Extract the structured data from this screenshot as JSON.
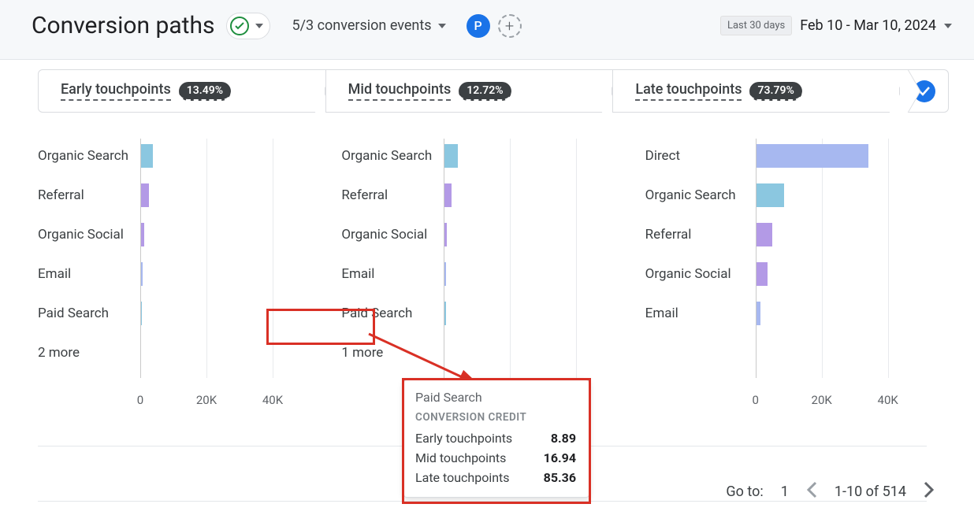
{
  "header": {
    "title": "Conversion paths",
    "events_label": "5/3 conversion events",
    "p_icon": "P",
    "date_label": "Last 30 days",
    "date_range": "Feb 10 - Mar 10, 2024"
  },
  "touchpoints": [
    {
      "label": "Early touchpoints",
      "pct": "13.49%"
    },
    {
      "label": "Mid touchpoints",
      "pct": "12.72%"
    },
    {
      "label": "Late touchpoints",
      "pct": "73.79%"
    }
  ],
  "chart_data": [
    {
      "type": "bar",
      "title": "Early touchpoints",
      "xlabel": "",
      "ylabel": "",
      "xlim": [
        0,
        50000
      ],
      "ticks": [
        "0",
        "20K",
        "40K"
      ],
      "series": [
        {
          "name": "credit",
          "values": [
            3600,
            2400,
            900,
            500,
            300
          ]
        }
      ],
      "categories": [
        "Organic Search",
        "Referral",
        "Organic Social",
        "Email",
        "Paid Search"
      ],
      "more_label": "2 more",
      "colors": [
        "teal",
        "purple",
        "purple",
        "lav",
        "teal"
      ]
    },
    {
      "type": "bar",
      "title": "Mid touchpoints",
      "xlabel": "",
      "ylabel": "",
      "xlim": [
        0,
        50000
      ],
      "ticks": [
        "0",
        "20K",
        "40K"
      ],
      "series": [
        {
          "name": "credit",
          "values": [
            4000,
            2000,
            700,
            500,
            300
          ]
        }
      ],
      "categories": [
        "Organic Search",
        "Referral",
        "Organic Social",
        "Email",
        "Paid Search"
      ],
      "more_label": "1 more",
      "colors": [
        "teal",
        "purple",
        "purple",
        "lav",
        "teal"
      ]
    },
    {
      "type": "bar",
      "title": "Late touchpoints",
      "xlabel": "",
      "ylabel": "",
      "xlim": [
        0,
        50000
      ],
      "ticks": [
        "0",
        "20K",
        "40K"
      ],
      "series": [
        {
          "name": "credit",
          "values": [
            34000,
            8500,
            4800,
            3500,
            1200
          ]
        }
      ],
      "categories": [
        "Direct",
        "Organic Search",
        "Referral",
        "Organic Social",
        "Email"
      ],
      "more_label": "",
      "colors": [
        "lav",
        "teal",
        "purple",
        "purple",
        "lav"
      ]
    }
  ],
  "tooltip": {
    "title": "Paid Search",
    "subtitle": "CONVERSION CREDIT",
    "rows": [
      {
        "label": "Early touchpoints",
        "value": "8.89"
      },
      {
        "label": "Mid touchpoints",
        "value": "16.94"
      },
      {
        "label": "Late touchpoints",
        "value": "85.36"
      }
    ]
  },
  "pagination": {
    "goto_label": "Go to:",
    "page": "1",
    "range": "1-10 of 514"
  }
}
